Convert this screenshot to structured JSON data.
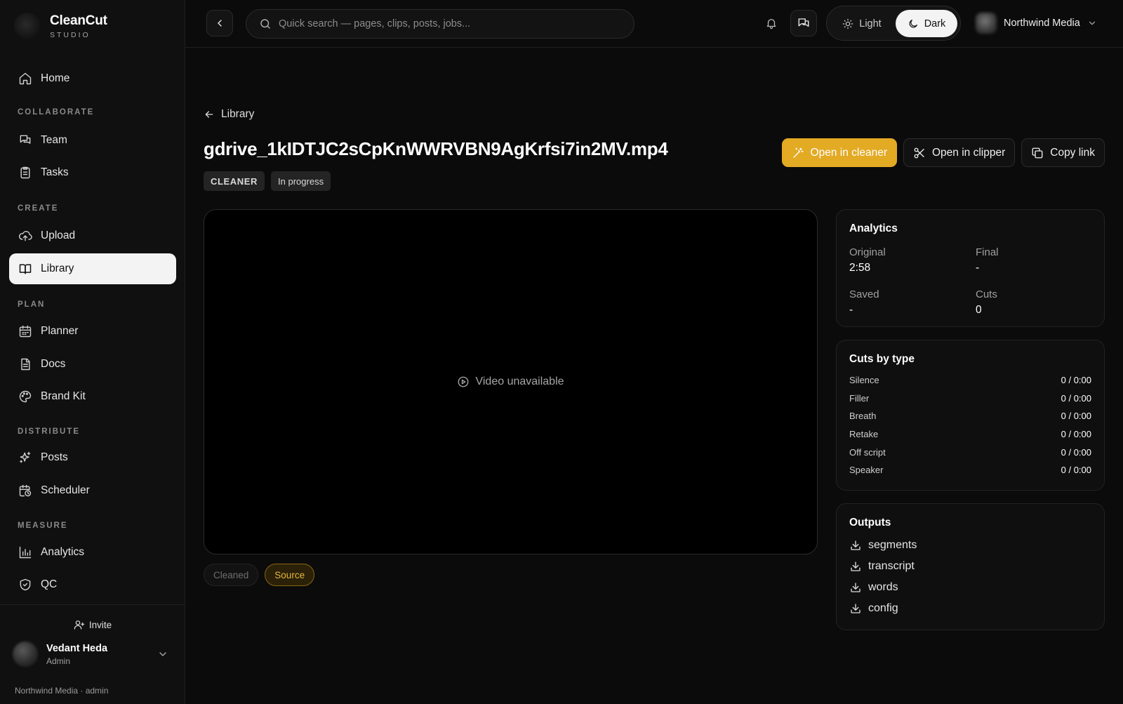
{
  "brand": {
    "name": "CleanCut",
    "sub": "STUDIO"
  },
  "sidebar": {
    "sections": [
      "COLLABORATE",
      "CREATE",
      "PLAN",
      "DISTRIBUTE",
      "MEASURE"
    ],
    "items": [
      {
        "label": "Home",
        "icon": "home-icon"
      },
      {
        "label": "Team",
        "icon": "team-icon"
      },
      {
        "label": "Tasks",
        "icon": "tasks-icon"
      },
      {
        "label": "Upload",
        "icon": "upload-icon"
      },
      {
        "label": "Library",
        "icon": "library-icon",
        "active": true
      },
      {
        "label": "Planner",
        "icon": "calendar-icon"
      },
      {
        "label": "Docs",
        "icon": "docs-icon"
      },
      {
        "label": "Brand Kit",
        "icon": "palette-icon"
      },
      {
        "label": "Posts",
        "icon": "sparkles-icon"
      },
      {
        "label": "Scheduler",
        "icon": "scheduler-icon"
      },
      {
        "label": "Analytics",
        "icon": "chart-icon"
      },
      {
        "label": "QC",
        "icon": "shield-icon"
      }
    ],
    "invite": "Invite",
    "user": {
      "name": "Vedant Heda",
      "role": "Admin"
    },
    "org_line": "Northwind Media · admin"
  },
  "topbar": {
    "search_placeholder": "Quick search — pages, clips, posts, jobs...",
    "theme_light": "Light",
    "theme_dark": "Dark",
    "theme_selected": "Dark",
    "account": "Northwind Media"
  },
  "page": {
    "breadcrumb": "Library",
    "title": "gdrive_1kIDTJC2sCpKnWWRVBN9AgKrfsi7in2MV.mp4",
    "badges": [
      "CLEANER",
      "In progress"
    ],
    "actions": {
      "open_cleaner": "Open in cleaner",
      "open_clipper": "Open in clipper",
      "copy_link": "Copy link"
    },
    "accent_color": "#e3aa24",
    "player_message": "Video unavailable",
    "tabs": {
      "cleaned": "Cleaned",
      "source": "Source",
      "selected": "Source"
    }
  },
  "analytics": {
    "title": "Analytics",
    "original_label": "Original",
    "original_value": "2:58",
    "final_label": "Final",
    "final_value": "-",
    "saved_label": "Saved",
    "saved_value": "-",
    "cuts_label": "Cuts",
    "cuts_value": "0"
  },
  "cuts_by_type": {
    "title": "Cuts by type",
    "rows": [
      {
        "name": "Silence",
        "value": "0 / 0:00"
      },
      {
        "name": "Filler",
        "value": "0 / 0:00"
      },
      {
        "name": "Breath",
        "value": "0 / 0:00"
      },
      {
        "name": "Retake",
        "value": "0 / 0:00"
      },
      {
        "name": "Off script",
        "value": "0 / 0:00"
      },
      {
        "name": "Speaker",
        "value": "0 / 0:00"
      }
    ]
  },
  "outputs": {
    "title": "Outputs",
    "items": [
      "segments",
      "transcript",
      "words",
      "config"
    ]
  }
}
